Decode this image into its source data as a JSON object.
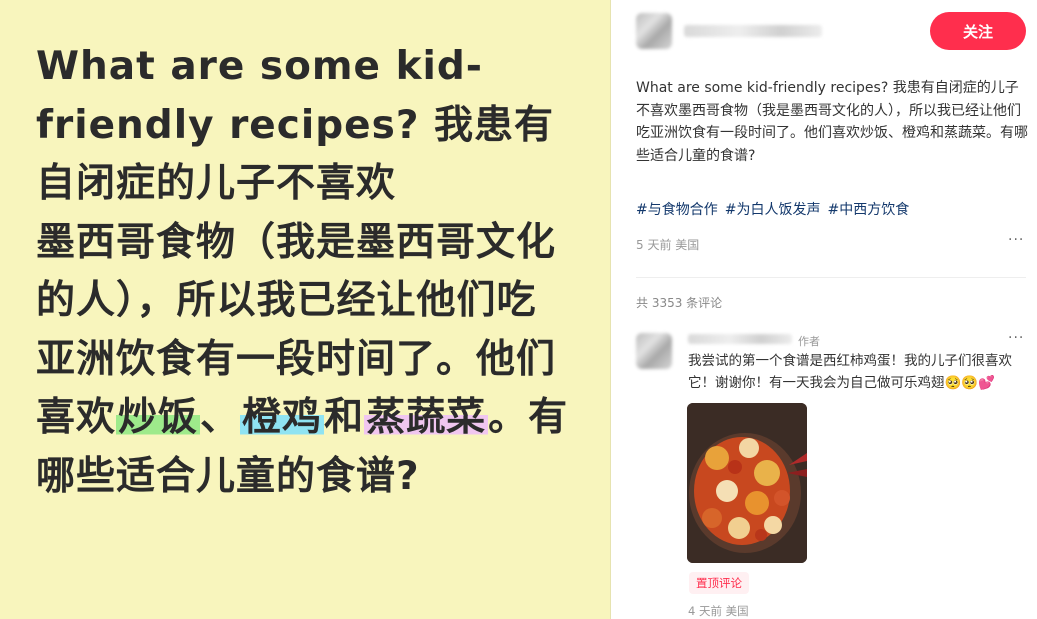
{
  "image_text": {
    "part1": "What are some kid-friendly recipes? 我患有自闭症的儿子不喜欢",
    "part2": "墨西哥食物（我是墨西哥文化的人），所以我已经让他们吃亚洲饮食有一段时间了。他们喜欢",
    "hl1": "炒饭",
    "sep": "、",
    "hl2": "橙鸡",
    "mid": "和",
    "hl3": "蒸蔬菜",
    "part3": "。有哪些适合儿童的食谱?"
  },
  "post": {
    "follow_label": "关注",
    "text": "What are some kid-friendly recipes? 我患有自闭症的儿子不喜欢墨西哥食物（我是墨西哥文化的人），所以我已经让他们吃亚洲饮食有一段时间了。他们喜欢炒饭、橙鸡和蒸蔬菜。有哪些适合儿童的食谱?",
    "tags": [
      "#与食物合作",
      "#为白人饭发声",
      "#中西方饮食"
    ],
    "meta": "5 天前 美国",
    "more": "···"
  },
  "comments": {
    "count_label": "共 3353 条评论",
    "first": {
      "author_tag": "作者",
      "text": "我尝试的第一个食谱是西红柿鸡蛋！我的儿子们很喜欢它！谢谢你！有一天我会为自己做可乐鸡翅🥺🥺💕",
      "pinned_label": "置顶评论",
      "meta": "4 天前 美国",
      "more": "···"
    }
  },
  "colors": {
    "left_bg": "#f8f5bd",
    "follow_bg": "#ff2e4d",
    "tag_color": "#13386c",
    "highlight_green": "#9eea8b",
    "highlight_blue": "#8fe3f2",
    "highlight_pink": "#f0c6f0"
  },
  "icons": {
    "post_more": "more-dots-icon",
    "comment_more": "more-dots-icon"
  }
}
